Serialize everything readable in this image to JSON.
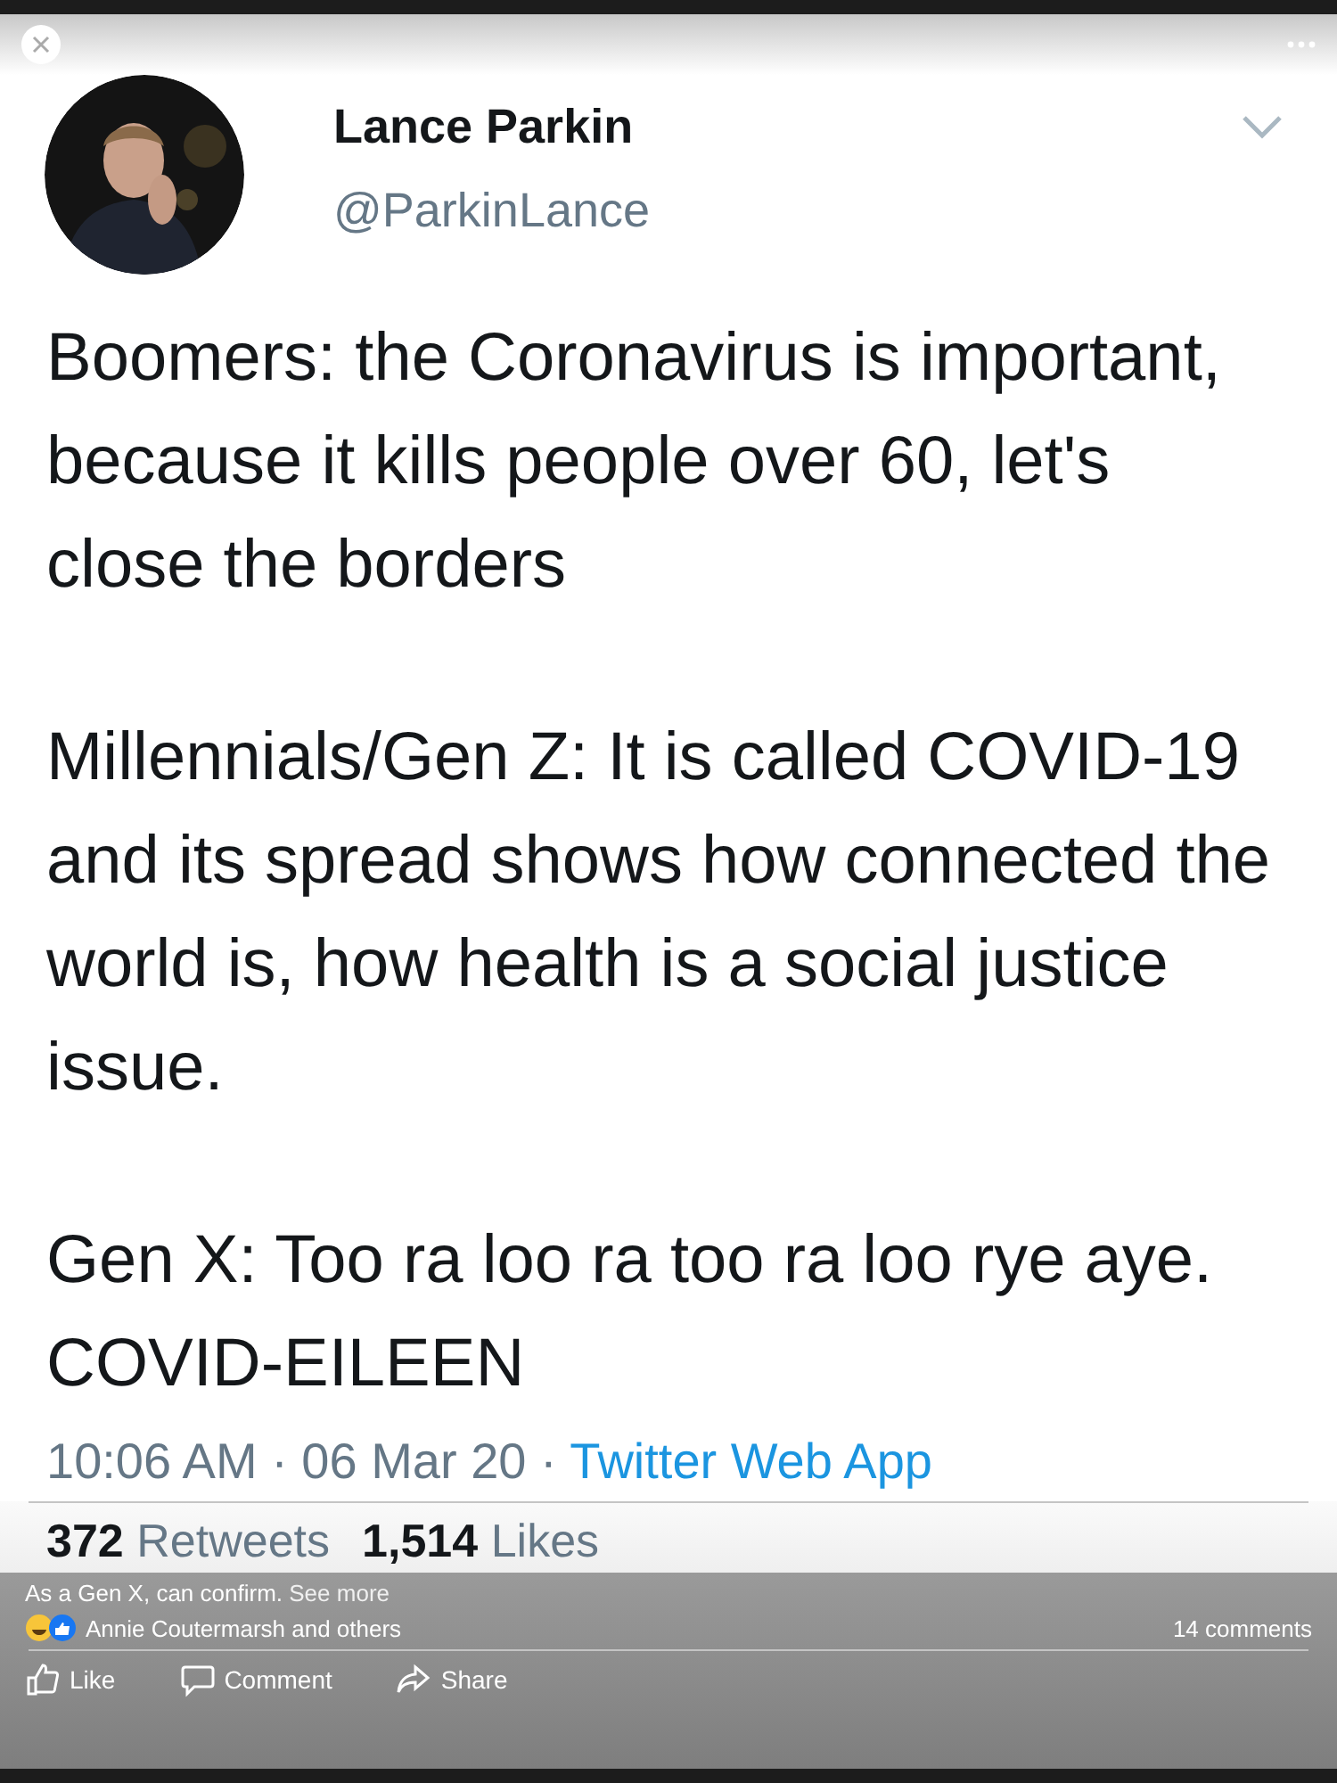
{
  "tweet": {
    "name": "Lance Parkin",
    "handle": "@ParkinLance",
    "paragraphs": [
      "Boomers: the Coronavirus is important, because it kills people over 60, let's close the borders",
      "Millennials/Gen Z: It is called COVID-19 and its spread shows how connected the world is, how health is a social justice issue.",
      "Gen X: Too ra loo ra too ra loo rye aye. COVID-EILEEN"
    ],
    "time": "10:06 AM · 06 Mar 20 · ",
    "source": "Twitter Web App",
    "retweets_count": "372",
    "retweets_label": "Retweets",
    "likes_count": "1,514",
    "likes_label": "Likes"
  },
  "post": {
    "caption": "As a Gen X, can confirm.",
    "see_more": "See more",
    "reactions": "Annie Coutermarsh and others",
    "comments": "14 comments",
    "actions": [
      {
        "kind": "like",
        "label": "Like"
      },
      {
        "kind": "comment",
        "label": "Comment"
      },
      {
        "kind": "share",
        "label": "Share"
      }
    ]
  }
}
